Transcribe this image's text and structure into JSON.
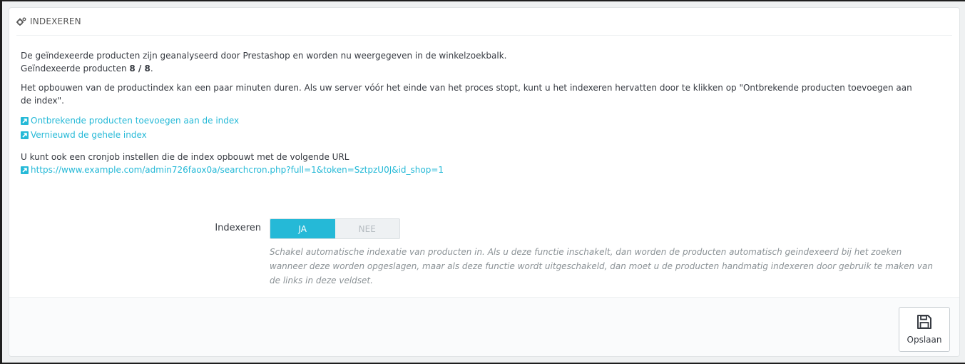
{
  "panel": {
    "title": "INDEXEREN"
  },
  "intro": {
    "line1": "De geïndexeerde producten zijn geanalyseerd door Prestashop en worden nu weergegeven in de winkelzoekbalk.",
    "indexed_label": "Geïndexeerde producten ",
    "indexed_count": "8 / 8",
    "indexed_suffix": "."
  },
  "info": "Het opbouwen van de productindex kan een paar minuten duren. Als uw server vóór het einde van het proces stopt, kunt u het indexeren hervatten door te klikken op \"Ontbrekende producten toevoegen aan de index\".",
  "links": {
    "add_missing": "Ontbrekende producten toevoegen aan de index",
    "rebuild": "Vernieuwd de gehele index"
  },
  "cron": {
    "text": "U kunt ook een cronjob instellen die de index opbouwt met de volgende URL",
    "url": "https://www.example.com/admin726faox0a/searchcron.php?full=1&token=SztpzU0J&id_shop=1"
  },
  "form": {
    "label": "Indexeren",
    "yes": "JA",
    "no": "NEE",
    "selected": "JA",
    "help": "Schakel automatische indexatie van producten in. Als u deze functie inschakelt, dan worden de producten automatisch geindexeerd bij het zoeken wanneer deze worden opgeslagen, maar als deze functie wordt uitgeschakeld, dan moet u de producten handmatig indexeren door gebruik te maken van de links in deze veldset."
  },
  "footer": {
    "save_label": "Opslaan"
  },
  "colors": {
    "accent": "#25b9d7",
    "text": "#363a41",
    "help_text": "#8b9296"
  },
  "icons": {
    "heading": "cogs-icon",
    "link": "external-link-icon",
    "save": "floppy-disk-icon"
  }
}
